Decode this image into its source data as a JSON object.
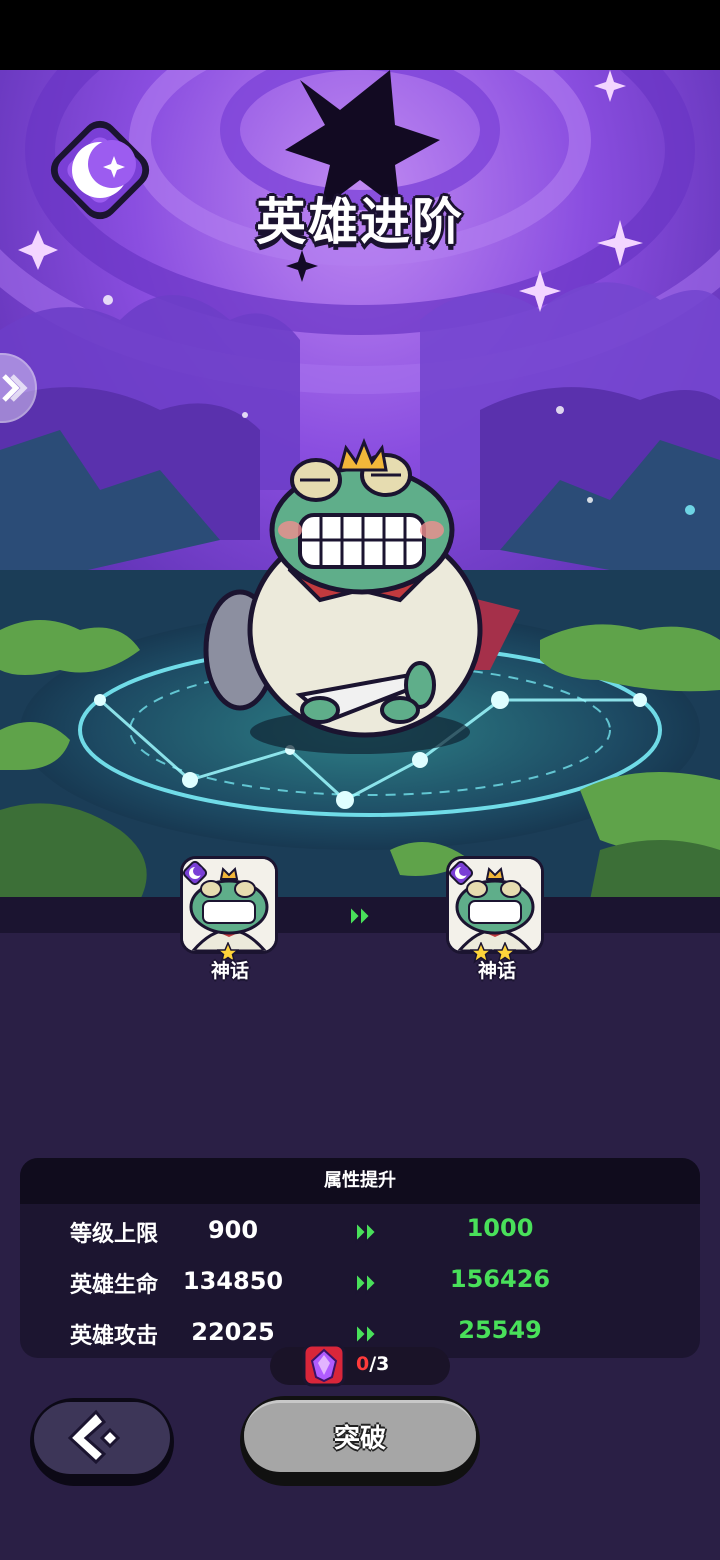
{
  "header": {
    "title": "英雄进阶"
  },
  "hero": {
    "from": {
      "rarity": "神话",
      "stars": 1
    },
    "to": {
      "rarity": "神话",
      "stars": 2
    }
  },
  "stats": {
    "heading": "属性提升",
    "rows": [
      {
        "label": "等级上限",
        "current": "900",
        "next": "1000"
      },
      {
        "label": "英雄生命",
        "current": "134850",
        "next": "156426"
      },
      {
        "label": "英雄攻击",
        "current": "22025",
        "next": "25549"
      }
    ]
  },
  "cost": {
    "have": "0",
    "need": "/3"
  },
  "actions": {
    "break_label": "突破"
  },
  "colors": {
    "accent_green": "#49e05a",
    "panel_bg": "#1c1530",
    "theme_purple": "#7a3fd6"
  }
}
